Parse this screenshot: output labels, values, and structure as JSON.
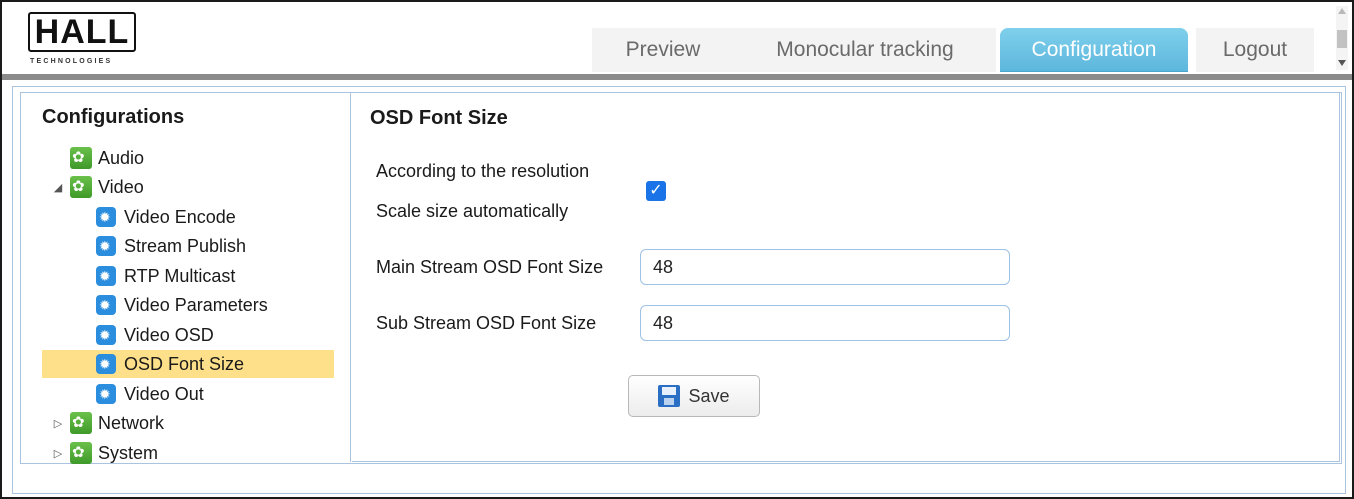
{
  "brand": {
    "logo_text": "HALL",
    "logo_subtext": "TECHNOLOGIES"
  },
  "nav": {
    "tabs": [
      {
        "label": "Preview",
        "active": false
      },
      {
        "label": "Monocular tracking",
        "active": false
      },
      {
        "label": "Configuration",
        "active": true
      },
      {
        "label": "Logout",
        "active": false
      }
    ]
  },
  "sidebar": {
    "title": "Configurations",
    "items": [
      {
        "label": "Audio",
        "level": 0,
        "expanded": null,
        "icon": "gear-green-icon"
      },
      {
        "label": "Video",
        "level": 0,
        "expanded": true,
        "icon": "gear-green-icon"
      },
      {
        "label": "Video Encode",
        "level": 1,
        "icon": "gear-blue-icon"
      },
      {
        "label": "Stream Publish",
        "level": 1,
        "icon": "gear-blue-icon"
      },
      {
        "label": "RTP Multicast",
        "level": 1,
        "icon": "gear-blue-icon"
      },
      {
        "label": "Video Parameters",
        "level": 1,
        "icon": "gear-blue-icon"
      },
      {
        "label": "Video OSD",
        "level": 1,
        "icon": "gear-blue-icon"
      },
      {
        "label": "OSD Font Size",
        "level": 1,
        "selected": true,
        "icon": "gear-blue-icon"
      },
      {
        "label": "Video Out",
        "level": 1,
        "icon": "gear-blue-icon"
      },
      {
        "label": "Network",
        "level": 0,
        "expanded": false,
        "icon": "gear-green-icon"
      },
      {
        "label": "System",
        "level": 0,
        "expanded": false,
        "icon": "gear-green-icon"
      }
    ]
  },
  "content": {
    "title": "OSD Font Size",
    "auto_label_1": "According to the resolution",
    "auto_label_2": "Scale size automatically",
    "auto_checked": true,
    "main_label": "Main Stream OSD Font Size",
    "main_value": "48",
    "sub_label": "Sub Stream OSD Font Size",
    "sub_value": "48",
    "save_label": "Save"
  },
  "colors": {
    "accent": "#5cb6dc",
    "selected_bg": "#ffe08a",
    "border": "#aac4e0",
    "checkbox": "#1b73e8"
  }
}
